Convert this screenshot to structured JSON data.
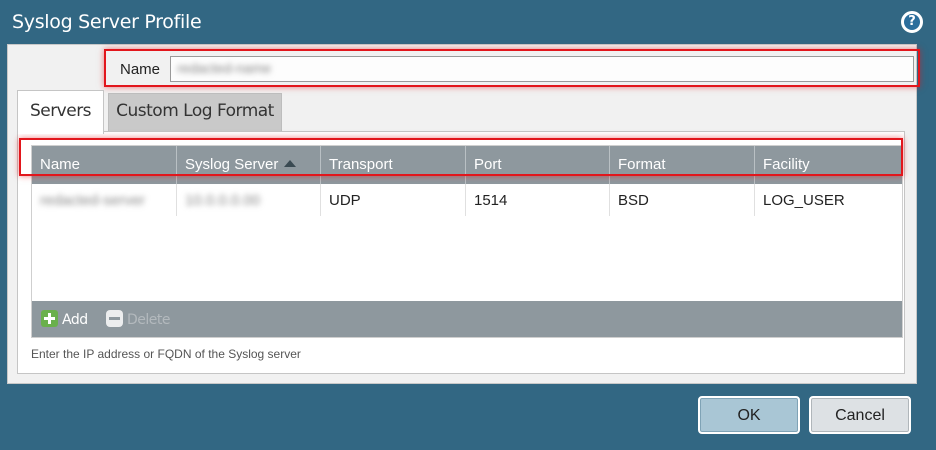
{
  "window": {
    "title": "Syslog Server Profile",
    "help_icon": "help-icon"
  },
  "form": {
    "name_label": "Name",
    "name_value": "redacted-name"
  },
  "tabs": [
    {
      "label": "Servers",
      "active": true
    },
    {
      "label": "Custom Log Format",
      "active": false
    }
  ],
  "table": {
    "columns": [
      "Name",
      "Syslog Server",
      "Transport",
      "Port",
      "Format",
      "Facility"
    ],
    "sort_column": "Syslog Server",
    "sort_direction": "ascending",
    "rows": [
      {
        "name": "redacted-server",
        "syslog_server": "10.0.0.0.00",
        "transport": "UDP",
        "port": "1514",
        "format": "BSD",
        "facility": "LOG_USER"
      }
    ],
    "toolbar": {
      "add_label": "Add",
      "delete_label": "Delete",
      "delete_enabled": false
    }
  },
  "hint": "Enter the IP address or FQDN of the Syslog server",
  "buttons": {
    "ok": "OK",
    "cancel": "Cancel"
  },
  "colors": {
    "window_bg": "#326783",
    "grid_header": "#8e989e",
    "highlight": "#e2161c",
    "add_icon": "#6ab04c"
  }
}
